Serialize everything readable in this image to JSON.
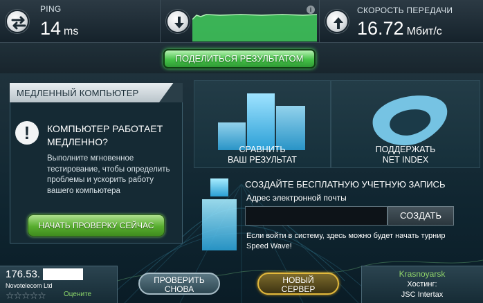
{
  "header": {
    "ping": {
      "label": "PING",
      "value": "14",
      "unit": "ms",
      "icon": "ping-icon"
    },
    "download": {
      "icon": "download-arrow-icon",
      "info_badge": "i"
    },
    "upload": {
      "label": "СКОРОСТЬ ПЕРЕДАЧИ",
      "value": "16.72",
      "unit": "Мбит/с",
      "icon": "upload-arrow-icon"
    }
  },
  "share": {
    "button_label": "ПОДЕЛИТЬСЯ РЕЗУЛЬТАТОМ"
  },
  "slow_pc": {
    "title": "МЕДЛЕННЫЙ КОМПЬЮТЕР",
    "icon_glyph": "!",
    "heading": "КОМПЬЮТЕР РАБОТАЕТ МЕДЛЕННО?",
    "text": "Выполните мгновенное тестирование, чтобы определить проблемы и ускорить работу вашего компьютера",
    "button_label": "НАЧАТЬ ПРОВЕРКУ СЕЙЧАС"
  },
  "tiles": {
    "compare": {
      "line1": "СРАВНИТЬ",
      "line2": "ВАШ РЕЗУЛЬТАТ"
    },
    "support": {
      "line1": "ПОДДЕРЖАТЬ",
      "line2": "NET INDEX"
    }
  },
  "signup": {
    "title": "СОЗДАЙТЕ БЕСПЛАТНУЮ УЧЕТНУЮ ЗАПИСЬ",
    "email_label": "Адрес электронной почты",
    "email_value": "",
    "create_label": "СОЗДАТЬ",
    "note": "Если войти в систему, здесь можно будет начать турнир Speed Wave!"
  },
  "footer": {
    "ip": "176.53.",
    "isp": "Novotelecom Ltd",
    "stars": "☆☆☆☆☆",
    "rate_label": "Оцените",
    "retry_line1": "ПРОВЕРИТЬ",
    "retry_line2": "СНОВА",
    "new_server_line1": "НОВЫЙ",
    "new_server_line2": "СЕРВЕР",
    "city": "Krasnoyarsk",
    "host_label": "Хостинг:",
    "host_name": "JSC Intertax"
  },
  "colors": {
    "accent_green": "#46c248",
    "gold": "#e3b93c",
    "link_green": "#8dd86a",
    "background": "#0b1a24"
  }
}
